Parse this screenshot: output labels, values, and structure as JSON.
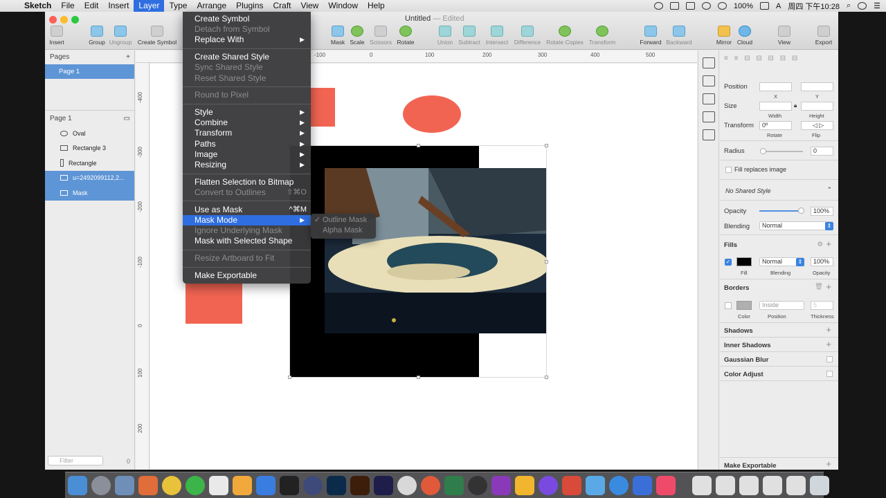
{
  "menubar": {
    "app_name": "Sketch",
    "items": [
      "File",
      "Edit",
      "Insert",
      "Layer",
      "Type",
      "Arrange",
      "Plugins",
      "Craft",
      "View",
      "Window",
      "Help"
    ],
    "active_item": "Layer",
    "battery": "100%",
    "clock": "周四 下午10:28",
    "input_source": "A"
  },
  "window": {
    "title": "Untitled",
    "edited_label": "— Edited"
  },
  "toolbar": {
    "left": [
      {
        "label": "Insert"
      },
      {
        "label": "Group"
      },
      {
        "label": "Ungroup"
      },
      {
        "label": "Create Symbol"
      }
    ],
    "middle": [
      {
        "label": "Mask"
      },
      {
        "label": "Scale"
      },
      {
        "label": "Scissors"
      },
      {
        "label": "Rotate"
      },
      {
        "label": "Union"
      },
      {
        "label": "Subtract"
      },
      {
        "label": "Intersect"
      },
      {
        "label": "Difference"
      },
      {
        "label": "Rotate Copies"
      },
      {
        "label": "Transform"
      },
      {
        "label": "Forward"
      },
      {
        "label": "Backward"
      },
      {
        "label": "Mirror"
      },
      {
        "label": "Cloud"
      },
      {
        "label": "View"
      },
      {
        "label": "Export"
      }
    ]
  },
  "sidebar": {
    "pages_header": "Pages",
    "pages": [
      "Page 1"
    ],
    "layers_header": "Page 1",
    "layers": [
      {
        "name": "Oval",
        "icon": "oval-icon"
      },
      {
        "name": "Rectangle 3",
        "icon": "rectangle-icon"
      },
      {
        "name": "Rectangle",
        "icon": "rectangle-icon"
      },
      {
        "name": "u=2492099112,2...",
        "icon": "image-icon"
      },
      {
        "name": "Mask",
        "icon": "mask-icon"
      }
    ],
    "filter_placeholder": "Filter",
    "filter_count": "0"
  },
  "rulers": {
    "horizontal": [
      "-100",
      "0",
      "100",
      "200",
      "300",
      "400",
      "500"
    ],
    "vertical": [
      "-400",
      "-300",
      "-200",
      "-100",
      "0",
      "100",
      "200"
    ]
  },
  "layer_menu": {
    "items": [
      {
        "label": "Create Symbol",
        "enabled": true
      },
      {
        "label": "Detach from Symbol",
        "enabled": false
      },
      {
        "label": "Replace With",
        "enabled": true,
        "submenu": true
      },
      {
        "sep": true
      },
      {
        "label": "Create Shared Style",
        "enabled": true
      },
      {
        "label": "Sync Shared Style",
        "enabled": false
      },
      {
        "label": "Reset Shared Style",
        "enabled": false
      },
      {
        "sep": true
      },
      {
        "label": "Round to Pixel",
        "enabled": false
      },
      {
        "sep": true
      },
      {
        "label": "Style",
        "enabled": true,
        "submenu": true
      },
      {
        "label": "Combine",
        "enabled": true,
        "submenu": true
      },
      {
        "label": "Transform",
        "enabled": true,
        "submenu": true
      },
      {
        "label": "Paths",
        "enabled": true,
        "submenu": true
      },
      {
        "label": "Image",
        "enabled": true,
        "submenu": true
      },
      {
        "label": "Resizing",
        "enabled": true,
        "submenu": true
      },
      {
        "sep": true
      },
      {
        "label": "Flatten Selection to Bitmap",
        "enabled": true
      },
      {
        "label": "Convert to Outlines",
        "enabled": false,
        "shortcut": "⇧⌘O"
      },
      {
        "sep": true
      },
      {
        "label": "Use as Mask",
        "enabled": true,
        "shortcut": "^⌘M"
      },
      {
        "label": "Mask Mode",
        "enabled": true,
        "submenu": true,
        "highlighted": true
      },
      {
        "label": "Ignore Underlying Mask",
        "enabled": false
      },
      {
        "label": "Mask with Selected Shape",
        "enabled": true
      },
      {
        "sep": true
      },
      {
        "label": "Resize Artboard to Fit",
        "enabled": false
      },
      {
        "sep": true
      },
      {
        "label": "Make Exportable",
        "enabled": true
      }
    ],
    "mask_mode_submenu": [
      {
        "label": "Outline Mask",
        "checked": true
      },
      {
        "label": "Alpha Mask",
        "checked": false
      }
    ]
  },
  "inspector": {
    "position_label": "Position",
    "x_label": "X",
    "y_label": "Y",
    "size_label": "Size",
    "width_label": "Width",
    "height_label": "Height",
    "transform_label": "Transform",
    "rotate_value": "0º",
    "rotate_label": "Rotate",
    "flip_label": "Flip",
    "radius_label": "Radius",
    "radius_value": "0",
    "fill_replaces_image": "Fill replaces image",
    "shared_style": "No Shared Style",
    "opacity_label": "Opacity",
    "opacity_value": "100%",
    "blending_label": "Blending",
    "blending_value": "Normal",
    "fills": {
      "header": "Fills",
      "color": "#000000",
      "blend": "Normal",
      "opacity": "100%",
      "fill_caption": "Fill",
      "blend_caption": "Blending",
      "opacity_caption": "Opacity"
    },
    "borders": {
      "header": "Borders",
      "position": "Inside",
      "thickness": "5",
      "color_caption": "Color",
      "position_caption": "Position",
      "thickness_caption": "Thickness"
    },
    "sections": [
      "Shadows",
      "Inner Shadows",
      "Gaussian Blur",
      "Color Adjust"
    ],
    "make_exportable": "Make Exportable"
  },
  "colors": {
    "accent_blue": "#2f6ee0",
    "shape_red": "#f26452",
    "selection_row": "#5e95d6"
  }
}
